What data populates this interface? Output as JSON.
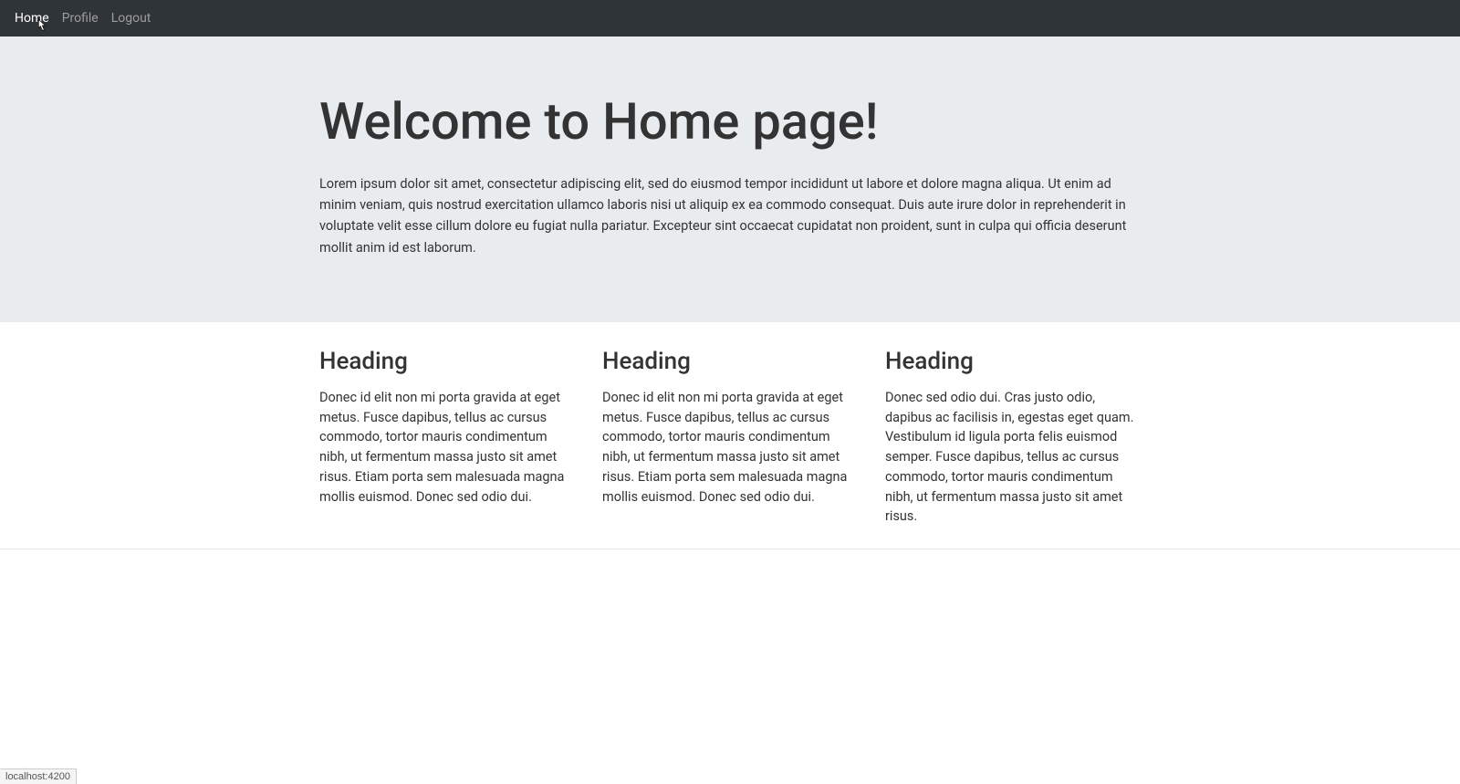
{
  "nav": {
    "items": [
      {
        "label": "Home",
        "active": true
      },
      {
        "label": "Profile",
        "active": false
      },
      {
        "label": "Logout",
        "active": false
      }
    ]
  },
  "hero": {
    "title": "Welcome to Home page!",
    "body": "Lorem ipsum dolor sit amet, consectetur adipiscing elit, sed do eiusmod tempor incididunt ut labore et dolore magna aliqua. Ut enim ad minim veniam, quis nostrud exercitation ullamco laboris nisi ut aliquip ex ea commodo consequat. Duis aute irure dolor in reprehenderit in voluptate velit esse cillum dolore eu fugiat nulla pariatur. Excepteur sint occaecat cupidatat non proident, sunt in culpa qui officia deserunt mollit anim id est laborum."
  },
  "columns": [
    {
      "heading": "Heading",
      "body": "Donec id elit non mi porta gravida at eget metus. Fusce dapibus, tellus ac cursus commodo, tortor mauris condimentum nibh, ut fermentum massa justo sit amet risus. Etiam porta sem malesuada magna mollis euismod. Donec sed odio dui."
    },
    {
      "heading": "Heading",
      "body": "Donec id elit non mi porta gravida at eget metus. Fusce dapibus, tellus ac cursus commodo, tortor mauris condimentum nibh, ut fermentum massa justo sit amet risus. Etiam porta sem malesuada magna mollis euismod. Donec sed odio dui."
    },
    {
      "heading": "Heading",
      "body": "Donec sed odio dui. Cras justo odio, dapibus ac facilisis in, egestas eget quam. Vestibulum id ligula porta felis euismod semper. Fusce dapibus, tellus ac cursus commodo, tortor mauris condimentum nibh, ut fermentum massa justo sit amet risus."
    }
  ],
  "status": {
    "text": "localhost:4200"
  }
}
